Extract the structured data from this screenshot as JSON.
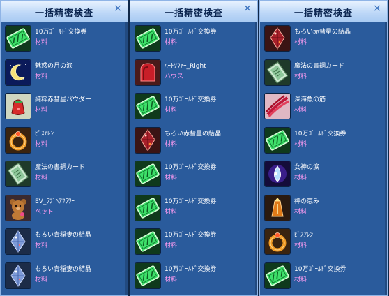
{
  "panels": [
    {
      "title": "一括精密検査",
      "close": "×",
      "items": [
        {
          "name": "10万ｺﾞｰﾙﾄﾞ交換券",
          "type": "材料",
          "icon": "gold-ticket-icon"
        },
        {
          "name": "魅惑の月の涙",
          "type": "材料",
          "icon": "moon-icon"
        },
        {
          "name": "純粋赤彗星パウダー",
          "type": "材料",
          "icon": "powder-bag-icon"
        },
        {
          "name": "ﾋﾟｽｱﾚﾝ",
          "type": "材料",
          "icon": "ring-icon"
        },
        {
          "name": "魔法の書鋼カード",
          "type": "材料",
          "icon": "card-icon"
        },
        {
          "name": "EV_ﾗﾌﾞﾍｱﾌﾗﾜｰ",
          "type": "ペット",
          "icon": "bear-icon"
        },
        {
          "name": "もろい青稲妻の結晶",
          "type": "材料",
          "icon": "blue-crystal-icon"
        },
        {
          "name": "もろい青稲妻の結晶",
          "type": "材料",
          "icon": "blue-crystal-icon"
        }
      ]
    },
    {
      "title": "一括精密検査",
      "close": "×",
      "items": [
        {
          "name": "10万ｺﾞｰﾙﾄﾞ交換券",
          "type": "材料",
          "icon": "gold-ticket-icon"
        },
        {
          "name": "ﾊｰﾄｿﾌｧｰ_Right",
          "type": "ハウス",
          "icon": "heart-sofa-icon"
        },
        {
          "name": "10万ｺﾞｰﾙﾄﾞ交換券",
          "type": "材料",
          "icon": "gold-ticket-icon"
        },
        {
          "name": "もろい赤彗星の結晶",
          "type": "材料",
          "icon": "red-crystal-icon"
        },
        {
          "name": "10万ｺﾞｰﾙﾄﾞ交換券",
          "type": "材料",
          "icon": "gold-ticket-icon"
        },
        {
          "name": "10万ｺﾞｰﾙﾄﾞ交換券",
          "type": "材料",
          "icon": "gold-ticket-icon"
        },
        {
          "name": "10万ｺﾞｰﾙﾄﾞ交換券",
          "type": "材料",
          "icon": "gold-ticket-icon"
        },
        {
          "name": "10万ｺﾞｰﾙﾄﾞ交換券",
          "type": "材料",
          "icon": "gold-ticket-icon"
        }
      ]
    },
    {
      "title": "一括精密検査",
      "close": "×",
      "items": [
        {
          "name": "もろい赤彗星の結晶",
          "type": "材料",
          "icon": "red-crystal-icon"
        },
        {
          "name": "魔法の書鋼カード",
          "type": "材料",
          "icon": "card-icon"
        },
        {
          "name": "深海魚の筋",
          "type": "材料",
          "icon": "fish-muscle-icon"
        },
        {
          "name": "10万ｺﾞｰﾙﾄﾞ交換券",
          "type": "材料",
          "icon": "gold-ticket-icon"
        },
        {
          "name": "女神の涙",
          "type": "材料",
          "icon": "goddess-tear-icon"
        },
        {
          "name": "神の恵み",
          "type": "材料",
          "icon": "blessing-icon"
        },
        {
          "name": "ﾋﾟｽｱﾚﾝ",
          "type": "材料",
          "icon": "ring-icon"
        },
        {
          "name": "10万ｺﾞｰﾙﾄﾞ交換券",
          "type": "材料",
          "icon": "gold-ticket-icon"
        }
      ]
    }
  ]
}
